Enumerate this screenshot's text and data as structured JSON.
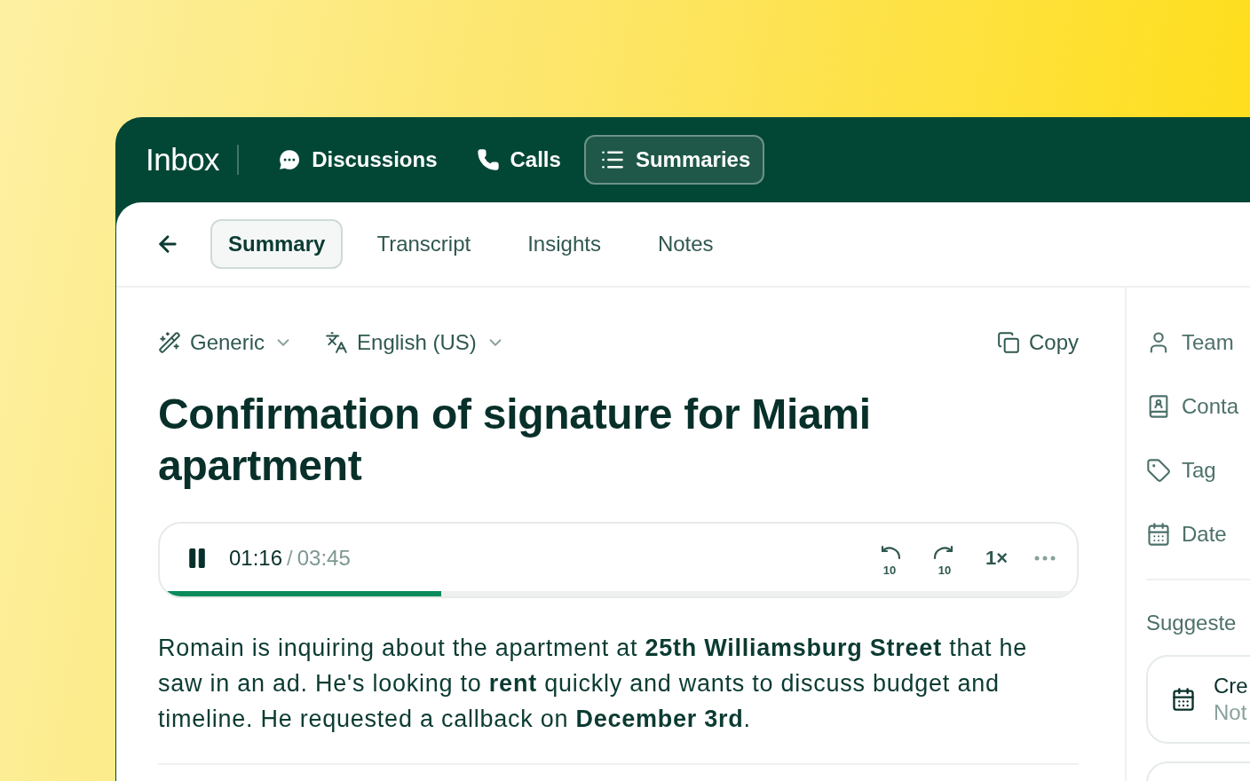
{
  "nav": {
    "title": "Inbox",
    "items": [
      {
        "label": "Discussions",
        "selected": false
      },
      {
        "label": "Calls",
        "selected": false
      },
      {
        "label": "Summaries",
        "selected": true
      }
    ]
  },
  "tabs": [
    {
      "label": "Summary",
      "selected": true
    },
    {
      "label": "Transcript",
      "selected": false
    },
    {
      "label": "Insights",
      "selected": false
    },
    {
      "label": "Notes",
      "selected": false
    }
  ],
  "toolbar": {
    "template": "Generic",
    "language": "English (US)",
    "copy": "Copy"
  },
  "title": "Confirmation of signature for Miami apartment",
  "player": {
    "playing": true,
    "current": "01:16",
    "separator": "/",
    "total": "03:45",
    "level": 0.307,
    "rewind": "10",
    "forward": "10",
    "speed": "1×"
  },
  "summary": "Romain is inquiring about the apartment at **25th Williamsburg Street** that he saw in an ad. He's looking to **rent** quickly and wants to discuss budget and timeline. He requested a callback on **December 3rd**.",
  "sidebar": {
    "fields": [
      {
        "label": "Team"
      },
      {
        "label": "Conta"
      },
      {
        "label": "Tag"
      },
      {
        "label": "Date"
      }
    ],
    "section": "Suggeste",
    "cards": [
      {
        "kind": "task",
        "title": "Cre",
        "subtitle": "Not"
      },
      {
        "kind": "empty"
      }
    ]
  }
}
